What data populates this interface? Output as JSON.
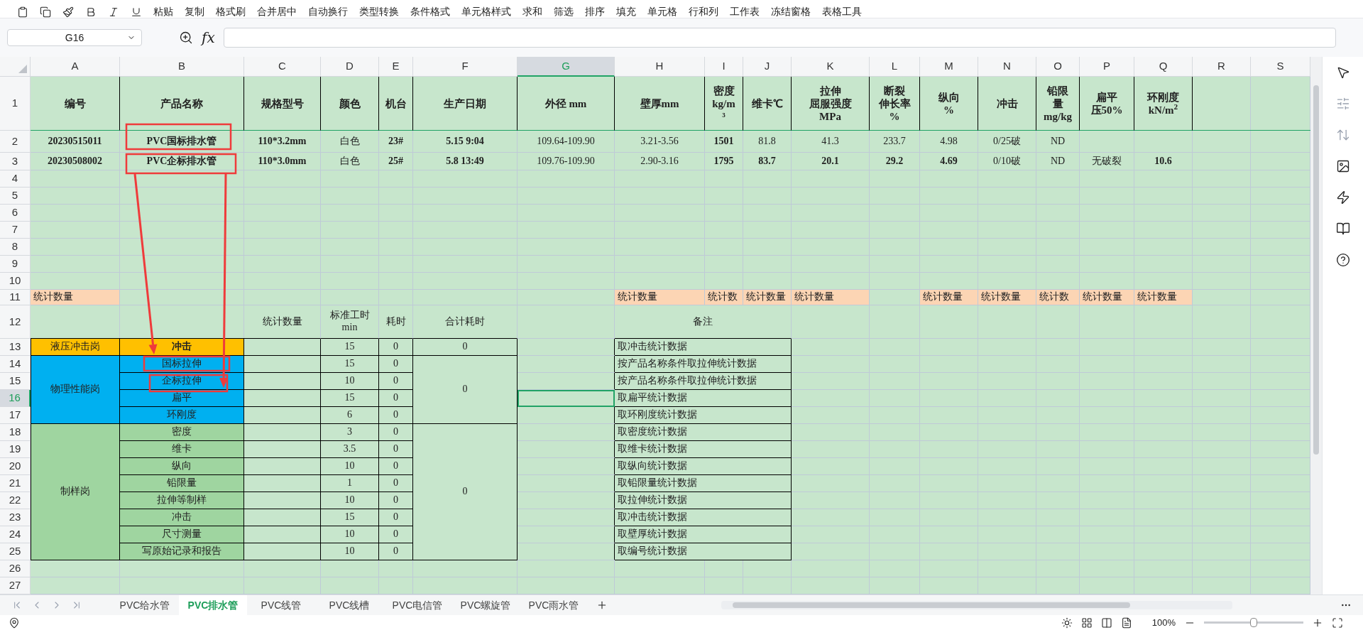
{
  "toolbar": {
    "items": [
      "粘贴",
      "复制",
      "格式刷",
      "合并居中",
      "自动换行",
      "类型转换",
      "条件格式",
      "单元格样式",
      "求和",
      "筛选",
      "排序",
      "填充",
      "单元格",
      "行和列",
      "工作表",
      "冻结窗格",
      "表格工具"
    ]
  },
  "formula_bar": {
    "name_box": "G16",
    "fx_label": "fx"
  },
  "sheet": {
    "columns": [
      {
        "label": "A",
        "selected": false
      },
      {
        "label": "B",
        "selected": false
      },
      {
        "label": "C",
        "selected": false
      },
      {
        "label": "D",
        "selected": false
      },
      {
        "label": "E",
        "selected": false
      },
      {
        "label": "F",
        "selected": false
      },
      {
        "label": "G",
        "selected": true
      },
      {
        "label": "H",
        "selected": false
      },
      {
        "label": "I",
        "selected": false
      },
      {
        "label": "J",
        "selected": false
      },
      {
        "label": "K",
        "selected": false
      },
      {
        "label": "L",
        "selected": false
      },
      {
        "label": "M",
        "selected": false
      },
      {
        "label": "N",
        "selected": false
      },
      {
        "label": "O",
        "selected": false
      },
      {
        "label": "P",
        "selected": false
      },
      {
        "label": "Q",
        "selected": false
      },
      {
        "label": "R",
        "selected": false
      },
      {
        "label": "S",
        "selected": false
      }
    ],
    "rows": [
      {
        "number": "1",
        "selected": false,
        "cells": [
          {
            "text": "编号",
            "bold": true
          },
          {
            "text": "产品名称",
            "bold": true
          },
          {
            "text": "规格型号",
            "bold": true
          },
          {
            "text": "颜色",
            "bold": true
          },
          {
            "text": "机台",
            "bold": true
          },
          {
            "text": "生产日期",
            "bold": true
          },
          {
            "text": "外径 mm",
            "bold": true
          },
          {
            "text": "壁厚mm",
            "bold": true
          },
          {
            "lines": [
              "密度",
              "kg/m",
              "³"
            ],
            "bold": true
          },
          {
            "text": "维卡℃",
            "bold": true
          },
          {
            "lines": [
              "拉伸",
              "屈服强度",
              "MPa"
            ],
            "bold": true
          },
          {
            "lines": [
              "断裂",
              "伸长率",
              "%"
            ],
            "bold": true
          },
          {
            "lines": [
              "纵向",
              "%"
            ],
            "bold": true
          },
          {
            "text": "冲击",
            "bold": true
          },
          {
            "lines": [
              "铅限",
              "量",
              "mg/kg"
            ],
            "bold": true
          },
          {
            "lines": [
              "扁平",
              "压50%"
            ],
            "bold": true
          },
          {
            "lines": [
              "环刚度",
              "kN/m$^{2}$"
            ],
            "bold": true
          }
        ]
      },
      {
        "number": "2",
        "selected": false,
        "cells": [
          {
            "text": "20230515011",
            "bold": true
          },
          {
            "text": "PVC国标排水管",
            "bold": true
          },
          {
            "text": "110*3.2mm",
            "bold": true
          },
          {
            "text": "白色",
            "bold": false
          },
          {
            "text": "23#",
            "bold": true
          },
          {
            "text": "5.15 9:04",
            "bold": true
          },
          {
            "text": "109.64-109.90",
            "bold": false
          },
          {
            "text": "3.21-3.56",
            "bold": false
          },
          {
            "text": "1501",
            "bold": true
          },
          {
            "text": "81.8",
            "bold": false
          },
          {
            "text": "41.3",
            "bold": false
          },
          {
            "text": "233.7",
            "bold": false
          },
          {
            "text": "4.98",
            "bold": false
          },
          {
            "text": "0/25破",
            "bold": false
          },
          {
            "text": "ND",
            "bold": false
          }
        ]
      },
      {
        "number": "3",
        "selected": false,
        "cells": [
          {
            "text": "20230508002",
            "bold": true
          },
          {
            "text": "PVC企标排水管",
            "bold": true
          },
          {
            "text": "110*3.0mm",
            "bold": true
          },
          {
            "text": "白色",
            "bold": false
          },
          {
            "text": "25#",
            "bold": true
          },
          {
            "text": "5.8 13:49",
            "bold": true
          },
          {
            "text": "109.76-109.90",
            "bold": false
          },
          {
            "text": "2.90-3.16",
            "bold": false
          },
          {
            "text": "1795",
            "bold": true
          },
          {
            "text": "83.7",
            "bold": true
          },
          {
            "text": "20.1",
            "bold": true
          },
          {
            "text": "29.2",
            "bold": true
          },
          {
            "text": "4.69",
            "bold": true
          },
          {
            "text": "0/10破",
            "bold": false
          },
          {
            "text": "ND",
            "bold": false
          },
          {
            "text": "无破裂",
            "bold": false
          },
          {
            "text": "10.6",
            "bold": true
          }
        ]
      },
      {
        "number": "4",
        "selected": false
      },
      {
        "number": "5",
        "selected": false
      },
      {
        "number": "6",
        "selected": false
      },
      {
        "number": "7",
        "selected": false
      },
      {
        "number": "8",
        "selected": false
      },
      {
        "number": "9",
        "selected": false
      },
      {
        "number": "10",
        "selected": false
      },
      {
        "number": "11",
        "selected": false,
        "cells": [
          {
            "text": "统计数量",
            "bold": false,
            "color": "#fcd5b4"
          },
          null,
          null,
          null,
          null,
          null,
          null,
          {
            "text": "统计数量",
            "bold": false,
            "color": "#fcd5b4"
          },
          {
            "text": "统计数",
            "bold": false,
            "color": "#fcd5b4"
          },
          {
            "text": "统计数量",
            "bold": false,
            "color": "#fcd5b4"
          },
          {
            "text": "统计数量",
            "bold": false,
            "color": "#fcd5b4"
          },
          null,
          {
            "text": "统计数量",
            "bold": false,
            "color": "#fcd5b4"
          },
          {
            "text": "统计数量",
            "bold": false,
            "color": "#fcd5b4"
          },
          {
            "text": "统计数",
            "bold": false,
            "color": "#fcd5b4"
          },
          {
            "text": "统计数量",
            "bold": false,
            "color": "#fcd5b4"
          },
          {
            "text": "统计数量",
            "bold": false,
            "color": "#fcd5b4"
          }
        ]
      },
      {
        "number": "12",
        "selected": false,
        "cells": [
          null,
          null,
          {
            "text": "统计数量",
            "bold": false
          },
          {
            "lines": [
              "标准工时",
              "min"
            ],
            "bold": false
          },
          {
            "text": "耗时",
            "bold": false
          },
          {
            "text": "合计耗时",
            "bold": false
          },
          null,
          {
            "text": "备注",
            "bold": false
          }
        ]
      },
      {
        "number": "13",
        "selected": false,
        "cells": [
          {
            "text": "液压冲击岗",
            "bold": false,
            "color": "#ffc000"
          },
          {
            "text": "冲击",
            "bold": true,
            "color": "#ffc000"
          },
          null,
          {
            "text": "15",
            "bold": false
          },
          {
            "text": "0",
            "bold": false
          },
          {
            "text": "0",
            "bold": false
          },
          null,
          {
            "text": "取冲击统计数据",
            "bold": false
          }
        ]
      },
      {
        "number": "14",
        "selected": false,
        "cells": [
          {
            "text": "物理性能岗",
            "bold": false,
            "color": "#00b0f0"
          },
          {
            "text": "国标拉伸",
            "bold": false,
            "color": "#00b0f0"
          },
          null,
          {
            "text": "15",
            "bold": false
          },
          {
            "text": "0",
            "bold": false
          },
          {
            "text": "0",
            "bold": false
          },
          null,
          {
            "text": "按产品名称条件取拉伸统计数据",
            "bold": false
          }
        ]
      },
      {
        "number": "15",
        "selected": false,
        "cells": [
          null,
          {
            "text": "企标拉伸",
            "bold": false,
            "color": "#00b0f0"
          },
          null,
          {
            "text": "10",
            "bold": false
          },
          {
            "text": "0",
            "bold": false
          },
          null,
          null,
          {
            "text": "按产品名称条件取拉伸统计数据",
            "bold": false
          }
        ]
      },
      {
        "number": "16",
        "selected": true,
        "cells": [
          null,
          {
            "text": "扁平",
            "bold": false,
            "color": "#00b0f0"
          },
          null,
          {
            "text": "15",
            "bold": false
          },
          {
            "text": "0",
            "bold": false
          },
          null,
          null,
          {
            "text": "取扁平统计数据",
            "bold": false
          }
        ]
      },
      {
        "number": "17",
        "selected": false,
        "cells": [
          null,
          {
            "text": "环刚度",
            "bold": false,
            "color": "#00b0f0"
          },
          null,
          {
            "text": "6",
            "bold": false
          },
          {
            "text": "0",
            "bold": false
          },
          null,
          null,
          {
            "text": "取环刚度统计数据",
            "bold": false
          }
        ]
      },
      {
        "number": "18",
        "selected": false,
        "cells": [
          {
            "text": "制样岗",
            "bold": false,
            "color": "#9fd5a0"
          },
          {
            "text": "密度",
            "bold": false,
            "color": "#9fd5a0"
          },
          null,
          {
            "text": "3",
            "bold": false
          },
          {
            "text": "0",
            "bold": false
          },
          {
            "text": "0",
            "bold": false
          },
          null,
          {
            "text": "取密度统计数据",
            "bold": false
          }
        ]
      },
      {
        "number": "19",
        "selected": false,
        "cells": [
          null,
          {
            "text": "维卡",
            "bold": false,
            "color": "#9fd5a0"
          },
          null,
          {
            "text": "3.5",
            "bold": false
          },
          {
            "text": "0",
            "bold": false
          },
          null,
          null,
          {
            "text": "取维卡统计数据",
            "bold": false
          }
        ]
      },
      {
        "number": "20",
        "selected": false,
        "cells": [
          null,
          {
            "text": "纵向",
            "bold": false,
            "color": "#9fd5a0"
          },
          null,
          {
            "text": "10",
            "bold": false
          },
          {
            "text": "0",
            "bold": false
          },
          null,
          null,
          {
            "text": "取纵向统计数据",
            "bold": false
          }
        ]
      },
      {
        "number": "21",
        "selected": false,
        "cells": [
          null,
          {
            "text": "铅限量",
            "bold": false,
            "color": "#9fd5a0"
          },
          null,
          {
            "text": "1",
            "bold": false
          },
          {
            "text": "0",
            "bold": false
          },
          null,
          null,
          {
            "text": "取铅限量统计数据",
            "bold": false
          }
        ]
      },
      {
        "number": "22",
        "selected": false,
        "cells": [
          null,
          {
            "text": "拉伸等制样",
            "bold": false,
            "color": "#9fd5a0"
          },
          null,
          {
            "text": "10",
            "bold": false
          },
          {
            "text": "0",
            "bold": false
          },
          null,
          null,
          {
            "text": "取拉伸统计数据",
            "bold": false
          }
        ]
      },
      {
        "number": "23",
        "selected": false,
        "cells": [
          null,
          {
            "text": "冲击",
            "bold": false,
            "color": "#9fd5a0"
          },
          null,
          {
            "text": "15",
            "bold": false
          },
          {
            "text": "0",
            "bold": false
          },
          null,
          null,
          {
            "text": "取冲击统计数据",
            "bold": false
          }
        ]
      },
      {
        "number": "24",
        "selected": false,
        "cells": [
          null,
          {
            "text": "尺寸测量",
            "bold": false,
            "color": "#9fd5a0"
          },
          null,
          {
            "text": "10",
            "bold": false
          },
          {
            "text": "0",
            "bold": false
          },
          null,
          null,
          {
            "text": "取壁厚统计数据",
            "bold": false
          }
        ]
      },
      {
        "number": "25",
        "selected": false,
        "cells": [
          null,
          {
            "text": "写原始记录和报告",
            "bold": false,
            "color": "#9fd5a0"
          },
          null,
          {
            "text": "10",
            "bold": false
          },
          {
            "text": "0",
            "bold": false
          },
          null,
          null,
          {
            "text": "取编号统计数据",
            "bold": false
          }
        ]
      },
      {
        "number": "26",
        "selected": false
      },
      {
        "number": "27",
        "selected": false
      }
    ]
  },
  "sheet_tabs": [
    {
      "label": "PVC给水管",
      "selected": false
    },
    {
      "label": "PVC排水管",
      "selected": true
    },
    {
      "label": "PVC线管",
      "selected": false
    },
    {
      "label": "PVC线槽",
      "selected": false
    },
    {
      "label": "PVC电信管",
      "selected": false
    },
    {
      "label": "PVC螺旋管",
      "selected": false
    },
    {
      "label": "PVC雨水管",
      "selected": false
    }
  ],
  "status_bar": {
    "zoom": "100%",
    "zoom_slider": {
      "level": 0.5
    }
  }
}
